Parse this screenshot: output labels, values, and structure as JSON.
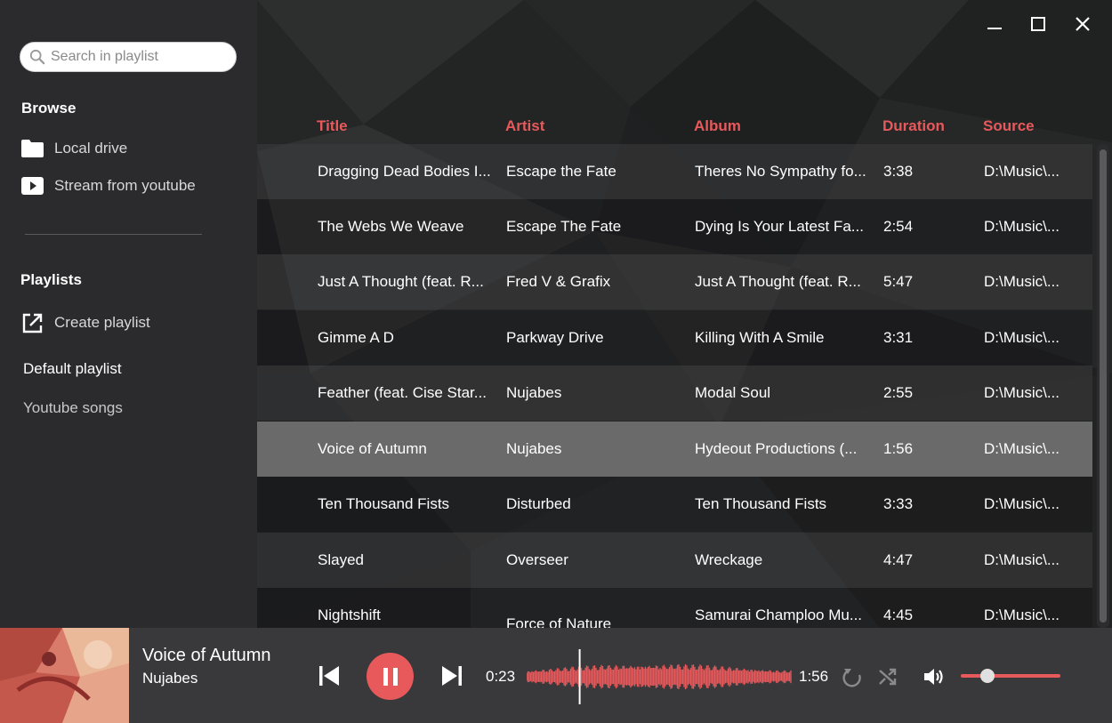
{
  "sidebar": {
    "search_placeholder": "Search in playlist",
    "browse_title": "Browse",
    "local_drive": "Local drive",
    "stream_youtube": "Stream from youtube",
    "playlists_title": "Playlists",
    "create_playlist": "Create playlist",
    "playlists": [
      "Default playlist",
      "Youtube songs"
    ]
  },
  "table": {
    "headers": {
      "title": "Title",
      "artist": "Artist",
      "album": "Album",
      "duration": "Duration",
      "source": "Source"
    },
    "rows": [
      {
        "title": "Dragging Dead Bodies I...",
        "artist": "Escape the Fate",
        "album": "Theres No Sympathy fo...",
        "duration": "3:38",
        "source": "D:\\Music\\..."
      },
      {
        "title": "The Webs We Weave",
        "artist": "Escape The Fate",
        "album": "Dying Is Your Latest Fa...",
        "duration": "2:54",
        "source": "D:\\Music\\..."
      },
      {
        "title": "Just A Thought (feat. R...",
        "artist": "Fred V & Grafix",
        "album": "Just A Thought (feat. R...",
        "duration": "5:47",
        "source": "D:\\Music\\..."
      },
      {
        "title": "Gimme A D",
        "artist": "Parkway Drive",
        "album": "Killing With A Smile",
        "duration": "3:31",
        "source": "D:\\Music\\..."
      },
      {
        "title": "Feather (feat. Cise Star...",
        "artist": "Nujabes",
        "album": "Modal Soul",
        "duration": "2:55",
        "source": "D:\\Music\\..."
      },
      {
        "title": "Voice of Autumn",
        "artist": "Nujabes",
        "album": "Hydeout Productions (...",
        "duration": "1:56",
        "source": "D:\\Music\\..."
      },
      {
        "title": "Ten Thousand Fists",
        "artist": "Disturbed",
        "album": "Ten Thousand Fists",
        "duration": "3:33",
        "source": "D:\\Music\\..."
      },
      {
        "title": "Slayed",
        "artist": "Overseer",
        "album": "Wreckage",
        "duration": "4:47",
        "source": "D:\\Music\\..."
      },
      {
        "title": "Nightshift",
        "artist": "Force of Nature",
        "album": "Samurai Champloo Mu...",
        "duration": "4:45",
        "source": "D:\\Music\\..."
      }
    ]
  },
  "player": {
    "title": "Voice of Autumn",
    "artist": "Nujabes",
    "elapsed": "0:23",
    "total": "1:56",
    "progress_fraction": 0.2,
    "volume_fraction": 0.2
  },
  "colors": {
    "accent": "#e8595c",
    "sidebar_bg": "#2b2b2d",
    "player_bg": "#39393b",
    "selected_row": "#6a6a6a"
  },
  "icons": [
    "search-icon",
    "folder-icon",
    "youtube-play-icon",
    "create-playlist-icon",
    "minimize-icon",
    "maximize-icon",
    "close-icon",
    "previous-icon",
    "pause-icon",
    "next-icon",
    "repeat-icon",
    "shuffle-icon",
    "volume-icon"
  ]
}
